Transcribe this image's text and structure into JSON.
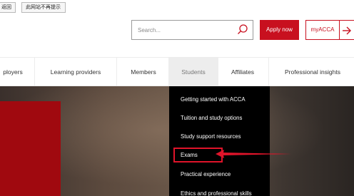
{
  "topbar": {
    "button1": "返回",
    "button2": "此网站不再提示"
  },
  "header": {
    "search_placeholder": "Search...",
    "apply_label": "Apply now",
    "myacca_label": "myACCA"
  },
  "nav": {
    "items": [
      "ployers",
      "Learning providers",
      "Members",
      "Students",
      "Affiliates",
      "Professional insights"
    ],
    "active": "Students"
  },
  "dropdown": {
    "items": [
      "Getting started with ACCA",
      "Tuition and study options",
      "Study support resources",
      "Exams",
      "Practical experience",
      "Ethics and professional skills"
    ],
    "highlighted": "Exams"
  },
  "colors": {
    "brand_red": "#c8101f",
    "dropdown_bg": "#000000",
    "annotation_red": "#e0142a"
  }
}
